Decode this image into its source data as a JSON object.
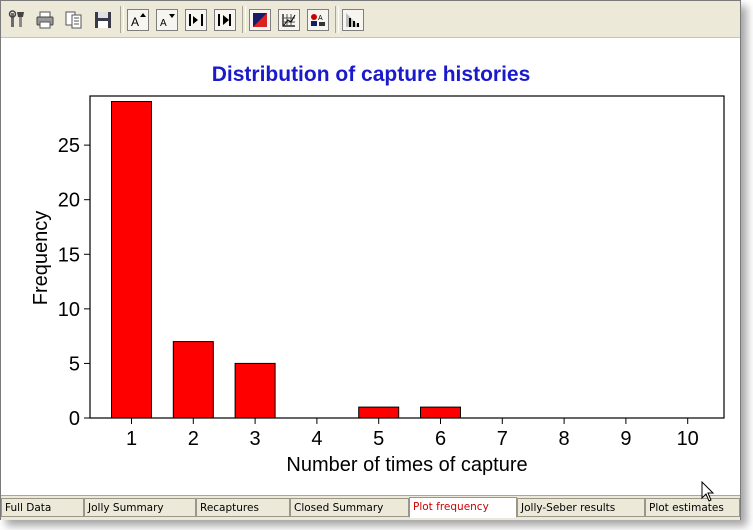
{
  "toolbar": {
    "buttons": [
      {
        "name": "tools-icon"
      },
      {
        "name": "print-icon"
      },
      {
        "name": "print-preview-icon"
      },
      {
        "name": "save-icon"
      },
      {
        "name": "increase-font-icon"
      },
      {
        "name": "decrease-font-icon"
      },
      {
        "name": "fit-width-icon"
      },
      {
        "name": "go-to-end-icon"
      },
      {
        "name": "color-fill-icon"
      },
      {
        "name": "grid-icon"
      },
      {
        "name": "legend-icon"
      },
      {
        "name": "axis-properties-icon"
      }
    ]
  },
  "chart_data": {
    "type": "bar",
    "title": "Distribution of capture histories",
    "xlabel": "Number of times of capture",
    "ylabel": "Frequency",
    "categories": [
      "1",
      "2",
      "3",
      "4",
      "5",
      "6",
      "7",
      "8",
      "9",
      "10"
    ],
    "values": [
      29,
      7,
      5,
      0,
      1,
      1,
      0,
      0,
      0,
      0
    ],
    "ylim": [
      0,
      29.5
    ],
    "yticks": [
      "0",
      "5",
      "10",
      "15",
      "20",
      "25"
    ],
    "bar_color": "#ff0000",
    "title_color": "#1a1acc",
    "grid": false,
    "legend": "none"
  },
  "tabs": [
    {
      "label": "Full Data"
    },
    {
      "label": "Jolly Summary"
    },
    {
      "label": "Recaptures"
    },
    {
      "label": "Closed Summary"
    },
    {
      "label": "Plot frequency",
      "active": true
    },
    {
      "label": "Jolly-Seber results"
    },
    {
      "label": "Plot estimates"
    }
  ]
}
